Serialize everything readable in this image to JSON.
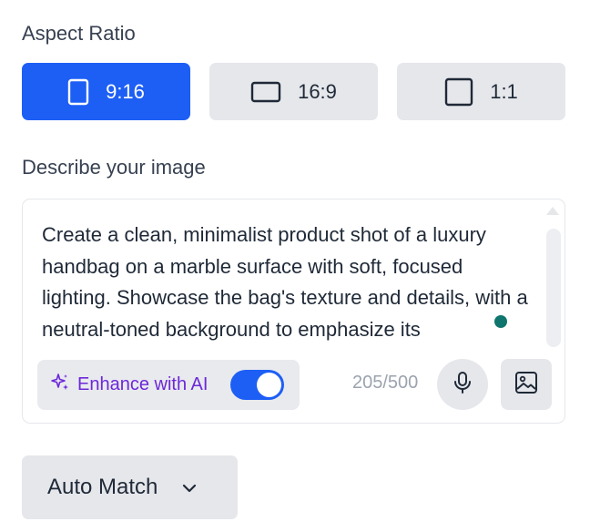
{
  "aspect_ratio": {
    "label": "Aspect Ratio",
    "options": [
      {
        "label": "9:16",
        "icon": "portrait-rect-icon",
        "active": true
      },
      {
        "label": "16:9",
        "icon": "landscape-rect-icon",
        "active": false
      },
      {
        "label": "1:1",
        "icon": "square-icon",
        "active": false
      }
    ]
  },
  "describe": {
    "label": "Describe your image",
    "prompt": "Create a clean, minimalist product shot of a luxury handbag on a marble surface with soft, focused lighting. Showcase the bag's texture and details, with a neutral-toned background to emphasize its",
    "enhance_label": "Enhance with AI",
    "enhance_enabled": true,
    "char_count": "205/500"
  },
  "auto_match": {
    "label": "Auto Match"
  },
  "colors": {
    "accent": "#1d5ff5",
    "enhance_text": "#6d28d9",
    "button_bg": "#e5e7eb"
  }
}
